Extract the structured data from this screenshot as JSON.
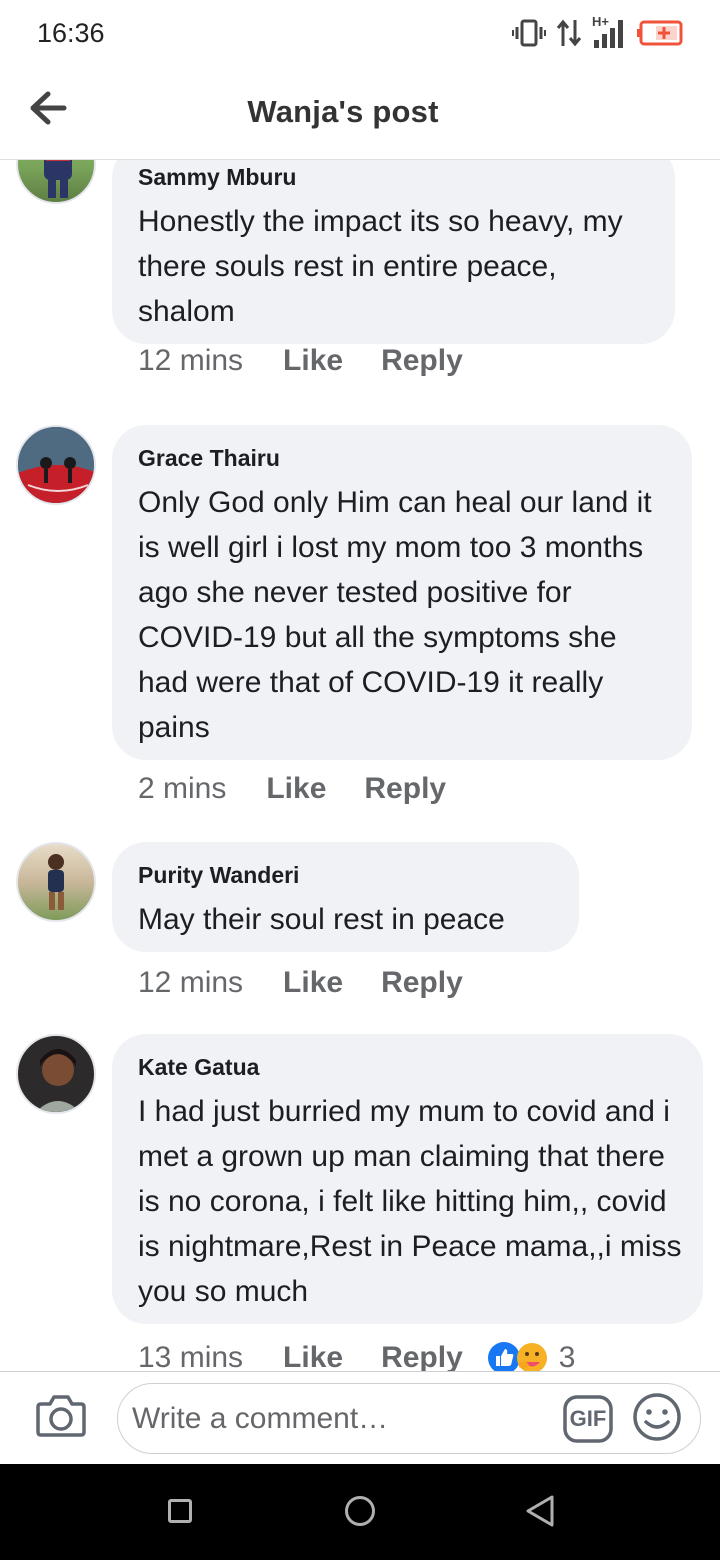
{
  "status_bar": {
    "time": "16:36",
    "icons": [
      "vibrate-icon",
      "data-transfer-icon",
      "h-plus-signal-icon",
      "battery-low-icon"
    ],
    "network_label": "H+"
  },
  "header": {
    "title": "Wanja's post",
    "back_icon": "arrow-left-icon"
  },
  "comments": [
    {
      "author": "Sammy Mburu",
      "text": "Honestly  the impact its so heavy, my there souls rest  in entire peace,  shalom",
      "time": "12 mins",
      "like_label": "Like",
      "reply_label": "Reply"
    },
    {
      "author": "Grace Thairu",
      "text": "Only God only Him can heal our land it is well girl i lost my mom too 3 months ago she never tested positive for COVID-19 but all the symptoms she had were that of COVID-19 it really pains",
      "time": "2 mins",
      "like_label": "Like",
      "reply_label": "Reply"
    },
    {
      "author": "Purity Wanderi",
      "text": "May their soul rest in peace",
      "time": "12 mins",
      "like_label": "Like",
      "reply_label": "Reply"
    },
    {
      "author": "Kate Gatua",
      "text": "I had just burried my mum to covid and i met a grown up man claiming that there is no corona, i felt like hitting him,, covid is nightmare,Rest in Peace mama,,i miss you so much",
      "time": "13 mins",
      "like_label": "Like",
      "reply_label": "Reply",
      "reactions": [
        "like-reaction-icon",
        "care-reaction-icon"
      ],
      "reaction_count": "3"
    }
  ],
  "composer": {
    "placeholder": "Write a comment…",
    "gif_label": "GIF",
    "camera_icon": "camera-icon",
    "emoji_icon": "smiley-icon"
  },
  "colors": {
    "bubble": "#f0f2f5",
    "secondary_text": "#65676b",
    "like_blue": "#1877f2",
    "battery": "#f0533a"
  }
}
